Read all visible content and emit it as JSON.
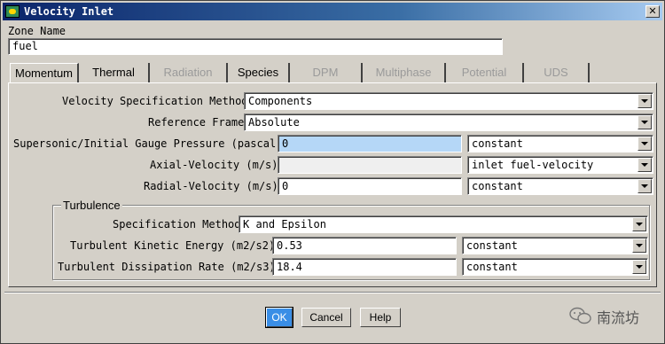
{
  "window": {
    "title": "Velocity Inlet"
  },
  "zone": {
    "label": "Zone Name",
    "value": "fuel"
  },
  "tabs": [
    {
      "label": "Momentum",
      "enabled": true,
      "active": true
    },
    {
      "label": "Thermal",
      "enabled": true
    },
    {
      "label": "Radiation",
      "enabled": false
    },
    {
      "label": "Species",
      "enabled": true
    },
    {
      "label": "DPM",
      "enabled": false
    },
    {
      "label": "Multiphase",
      "enabled": false
    },
    {
      "label": "Potential",
      "enabled": false
    },
    {
      "label": "UDS",
      "enabled": false
    }
  ],
  "momentum": {
    "velocity_spec": {
      "label": "Velocity Specification Method",
      "value": "Components"
    },
    "reference_frame": {
      "label": "Reference Frame",
      "value": "Absolute"
    },
    "pressure": {
      "label": "Supersonic/Initial Gauge Pressure (pascal)",
      "value": "0",
      "profile": "constant"
    },
    "axial_velocity": {
      "label": "Axial-Velocity (m/s)",
      "value": "",
      "profile": "inlet fuel-velocity"
    },
    "radial_velocity": {
      "label": "Radial-Velocity (m/s)",
      "value": "0",
      "profile": "constant"
    }
  },
  "turbulence": {
    "group_label": "Turbulence",
    "spec_method": {
      "label": "Specification Method",
      "value": "K and Epsilon"
    },
    "kinetic_energy": {
      "label": "Turbulent Kinetic Energy (m2/s2)",
      "value": "0.53",
      "profile": "constant"
    },
    "dissipation_rate": {
      "label": "Turbulent Dissipation Rate (m2/s3)",
      "value": "18.4",
      "profile": "constant"
    }
  },
  "buttons": {
    "ok": "OK",
    "cancel": "Cancel",
    "help": "Help"
  },
  "watermark": "南流坊",
  "colors": {
    "title_start": "#0a246a",
    "title_end": "#a6caf0",
    "selection": "#b5d7f7",
    "dialog_bg": "#d4d0c8"
  }
}
